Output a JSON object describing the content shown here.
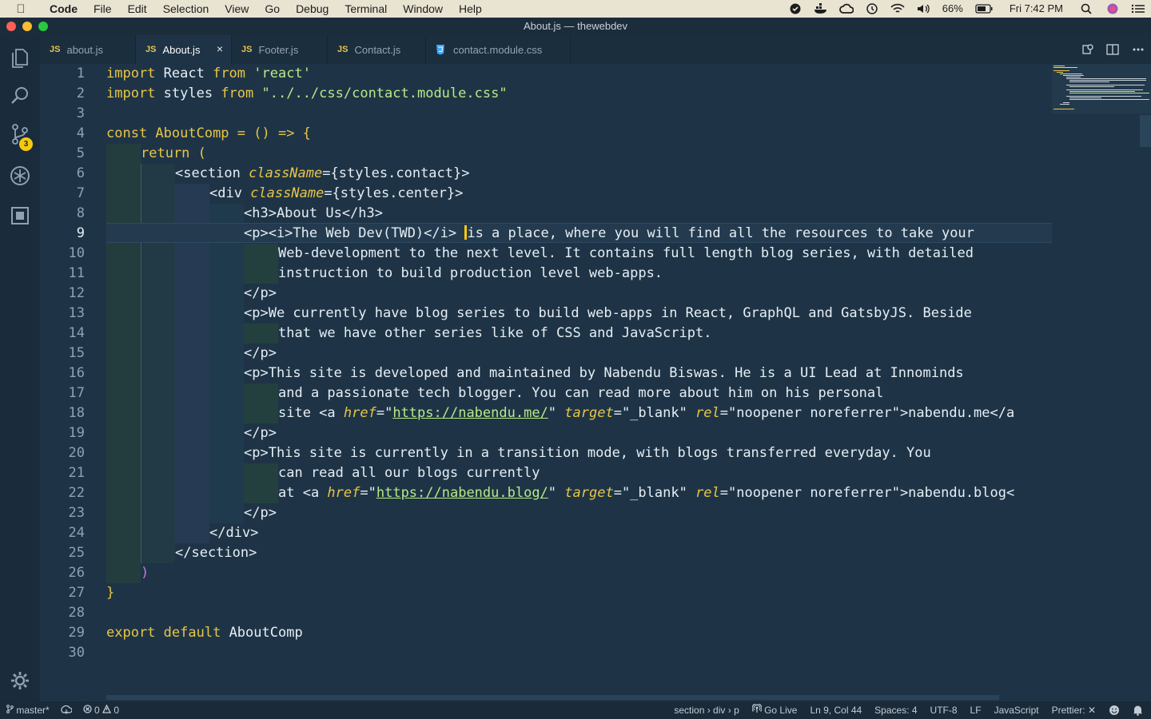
{
  "menubar": {
    "app": "Code",
    "items": [
      "File",
      "Edit",
      "Selection",
      "View",
      "Go",
      "Debug",
      "Terminal",
      "Window",
      "Help"
    ],
    "battery": "66%",
    "clock": "Fri 7:42 PM"
  },
  "window": {
    "title": "About.js — thewebdev"
  },
  "activity": {
    "scm_badge": "3"
  },
  "tabs": [
    {
      "lang": "JS",
      "label": "about.js"
    },
    {
      "lang": "JS",
      "label": "About.js",
      "active": true,
      "close": "×"
    },
    {
      "lang": "JS",
      "label": "Footer.js"
    },
    {
      "lang": "JS",
      "label": "Contact.js"
    },
    {
      "lang": "CSS",
      "label": "contact.module.css"
    }
  ],
  "editor": {
    "line_numbers": [
      "1",
      "2",
      "3",
      "4",
      "5",
      "6",
      "7",
      "8",
      "9",
      "10",
      "11",
      "12",
      "13",
      "14",
      "15",
      "16",
      "17",
      "18",
      "19",
      "20",
      "21",
      "22",
      "23",
      "24",
      "25",
      "26",
      "27",
      "28",
      "29",
      "30"
    ],
    "code": {
      "l1": {
        "kw1": "import",
        "id": " React ",
        "kw2": "from",
        "sp": " ",
        "str": "'react'"
      },
      "l2": {
        "kw1": "import",
        "id": " styles ",
        "kw2": "from",
        "sp": " ",
        "str": "\"../../css/contact.module.css\""
      },
      "l4": {
        "kw": "const",
        "id": " AboutComp ",
        "op": "= () => {"
      },
      "l5": {
        "kw": "return",
        "p": " ("
      },
      "l6": {
        "tag": "<section ",
        "attr": "className",
        "rest": "={styles.contact}>"
      },
      "l7": {
        "tag": "<div ",
        "attr": "className",
        "rest": "={styles.center}>"
      },
      "l8": "<h3>About Us</h3>",
      "l9": {
        "a": "<p><i>The Web Dev(TWD)</i> ",
        "b": "is a place, where you will find all the resources to take your"
      },
      "l10": "Web-development to the next level. It contains full length blog series, with detailed",
      "l11": "instruction to build production level web-apps.",
      "l12": "</p>",
      "l13": "<p>We currently have blog series to build web-apps in React, GraphQL and GatsbyJS. Beside",
      "l14": "that we have other series like of CSS and JavaScript.",
      "l15": "</p>",
      "l16": "<p>This site is developed and maintained by Nabendu Biswas. He is a UI Lead at Innominds",
      "l17": "and a passionate tech blogger. You can read more about him on his personal",
      "l18": {
        "a": "site <a ",
        "href": "href",
        "eq1": "=\"",
        "url": "https://nabendu.me/",
        "q1": "\" ",
        "target": "target",
        "tv": "=\"_blank\" ",
        "rel": "rel",
        "rv": "=\"noopener noreferrer\">nabendu.me</a"
      },
      "l19": "</p>",
      "l20": "<p>This site is currently in a transition mode, with blogs transferred everyday. You",
      "l21": "can read all our blogs currently",
      "l22": {
        "a": "at <a ",
        "href": "href",
        "eq1": "=\"",
        "url": "https://nabendu.blog/",
        "q1": "\" ",
        "target": "target",
        "tv": "=\"_blank\" ",
        "rel": "rel",
        "rv": "=\"noopener noreferrer\">nabendu.blog<"
      },
      "l23": "</p>",
      "l24": "</div>",
      "l25": "</section>",
      "l26": ")",
      "l27": "}",
      "l29": {
        "kw1": "export",
        "sp": " ",
        "kw2": "default",
        "id": " AboutComp"
      }
    }
  },
  "statusbar": {
    "branch": "master*",
    "errors": "0",
    "warnings": "0",
    "breadcrumb": "section › div › p",
    "golive": "Go Live",
    "position": "Ln 9, Col 44",
    "spaces": "Spaces: 4",
    "encoding": "UTF-8",
    "eol": "LF",
    "language": "JavaScript",
    "prettier": "Prettier: ✕"
  },
  "colors": {
    "accent": "#f6c90e",
    "keyword": "#e8c547",
    "string": "#b8e986",
    "background": "#1e3446"
  }
}
